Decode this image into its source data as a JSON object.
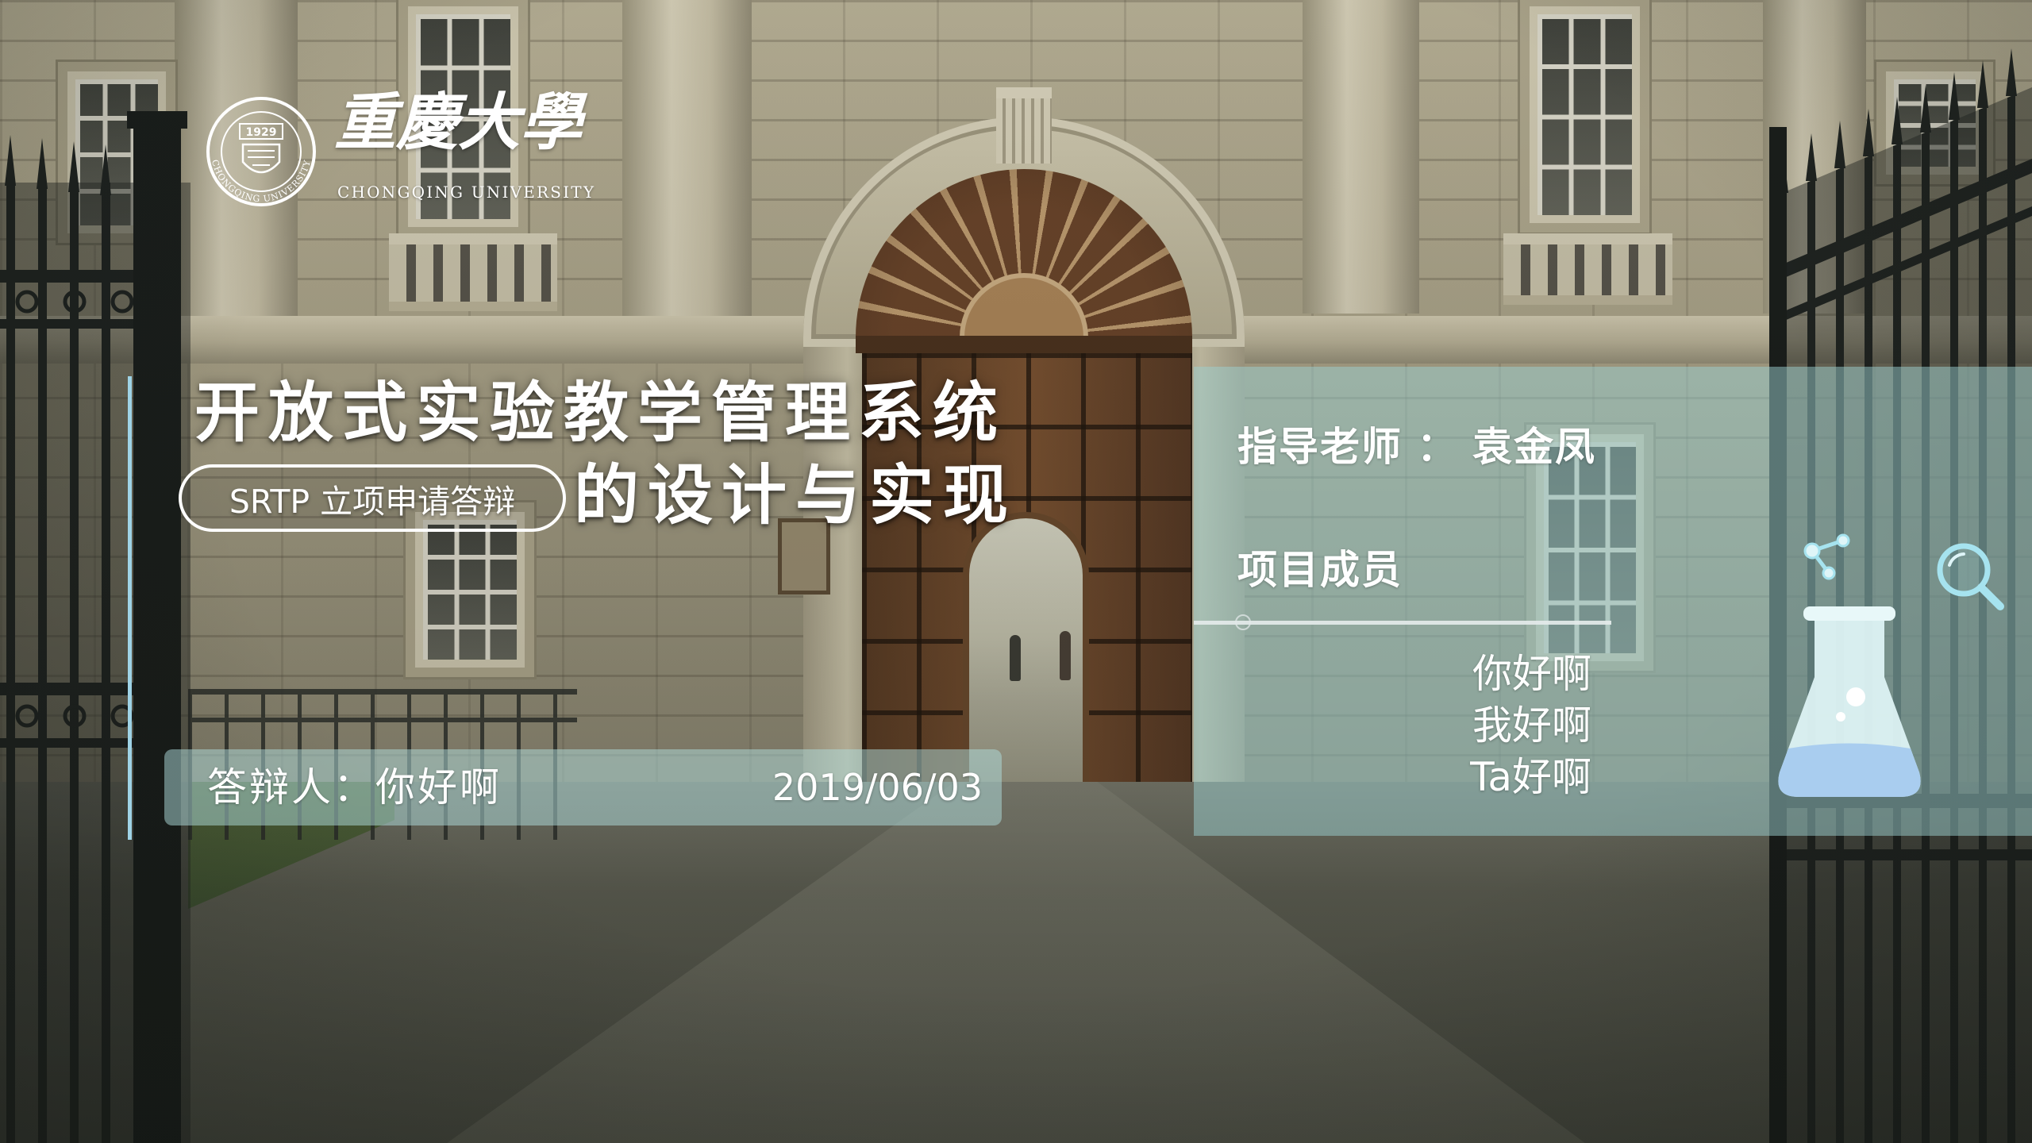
{
  "logo": {
    "name_cn": "重慶大學",
    "name_en": "CHONGQING UNIVERSITY",
    "seal_year": "1929",
    "seal_ring_text": "CHONGQING UNIVERSITY"
  },
  "title": {
    "line1": "开放式实验教学管理系统",
    "tag": "SRTP 立项申请答辩",
    "line2": "的设计与实现"
  },
  "presenter_bar": {
    "presenter": "答辩人：你好啊",
    "date": "2019/06/03"
  },
  "team_panel": {
    "advisor_label": "指导老师",
    "advisor_separator": "：",
    "advisor_name": "袁金凤",
    "members_label": "项目成员",
    "members": [
      "你好啊",
      "我好啊",
      "Ta好啊"
    ]
  },
  "icons": [
    "university-seal-icon",
    "molecule-icon",
    "magnifier-icon",
    "flask-icon"
  ],
  "colors": {
    "accent_line": "#9fd3e6",
    "panel_tint": "#9cd0d0",
    "icon_stroke": "#a6e3ef",
    "flask_body": "#e1f6f7",
    "flask_liquid": "#a9cdef",
    "text": "#ffffff"
  }
}
